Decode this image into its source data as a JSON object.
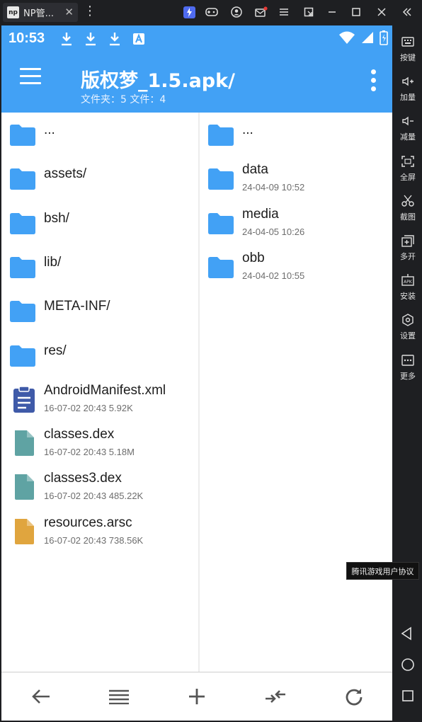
{
  "emulator": {
    "tab_title": "NP管...",
    "tab_icon_text": "np",
    "more_icon": "⋮",
    "controls": [
      "bolt-icon",
      "gamepad-icon",
      "account-icon",
      "mail-icon",
      "menu-icon",
      "popout-icon",
      "minimize-icon",
      "maximize-icon",
      "close-icon",
      "collapse-icon"
    ],
    "sidebar": [
      {
        "label": "按键",
        "icon": "keyboard-icon"
      },
      {
        "label": "加量",
        "icon": "volume-up-icon"
      },
      {
        "label": "减量",
        "icon": "volume-down-icon"
      },
      {
        "label": "全屏",
        "icon": "fullscreen-icon"
      },
      {
        "label": "截图",
        "icon": "scissors-icon"
      },
      {
        "label": "多开",
        "icon": "multi-instance-icon"
      },
      {
        "label": "安装",
        "icon": "apk-install-icon"
      },
      {
        "label": "设置",
        "icon": "settings-icon"
      },
      {
        "label": "更多",
        "icon": "more-icon"
      }
    ],
    "tooltip": "腾讯游戏用户协议",
    "nav": [
      "back-triangle-icon",
      "home-circle-icon",
      "recents-square-icon"
    ]
  },
  "status_bar": {
    "time": "10:53",
    "icons": [
      "download-icon",
      "download-icon",
      "download-icon",
      "a-icon",
      "wifi-icon",
      "signal-icon",
      "battery-icon"
    ]
  },
  "app_bar": {
    "title": "版权梦_1.5.apk/",
    "subtitle": "文件夹：5 文件：4"
  },
  "left_pane": {
    "items": [
      {
        "name": "...",
        "type": "folder",
        "meta": ""
      },
      {
        "name": "assets/",
        "type": "folder",
        "meta": ""
      },
      {
        "name": "bsh/",
        "type": "folder",
        "meta": ""
      },
      {
        "name": "lib/",
        "type": "folder",
        "meta": ""
      },
      {
        "name": "META-INF/",
        "type": "folder",
        "meta": ""
      },
      {
        "name": "res/",
        "type": "folder",
        "meta": ""
      },
      {
        "name": "AndroidManifest.xml",
        "type": "xml",
        "meta": "16-07-02 20:43  5.92K"
      },
      {
        "name": "classes.dex",
        "type": "dex",
        "meta": "16-07-02 20:43  5.18M"
      },
      {
        "name": "classes3.dex",
        "type": "dex",
        "meta": "16-07-02 20:43  485.22K"
      },
      {
        "name": "resources.arsc",
        "type": "arsc",
        "meta": "16-07-02 20:43  738.56K"
      }
    ]
  },
  "right_pane": {
    "items": [
      {
        "name": "...",
        "type": "folder",
        "meta": ""
      },
      {
        "name": "data",
        "type": "folder",
        "meta": "24-04-09 10:52"
      },
      {
        "name": "media",
        "type": "folder",
        "meta": "24-04-05 10:26"
      },
      {
        "name": "obb",
        "type": "folder",
        "meta": "24-04-02 10:55"
      }
    ]
  },
  "bottom_bar": [
    "back-arrow-icon",
    "list-icon",
    "plus-icon",
    "swap-icon",
    "refresh-icon"
  ],
  "colors": {
    "accent": "#42a1f5",
    "folder": "#42a1f5",
    "xml": "#3f5aa8",
    "dex": "#5fa3a3",
    "arsc": "#e0a53e"
  }
}
